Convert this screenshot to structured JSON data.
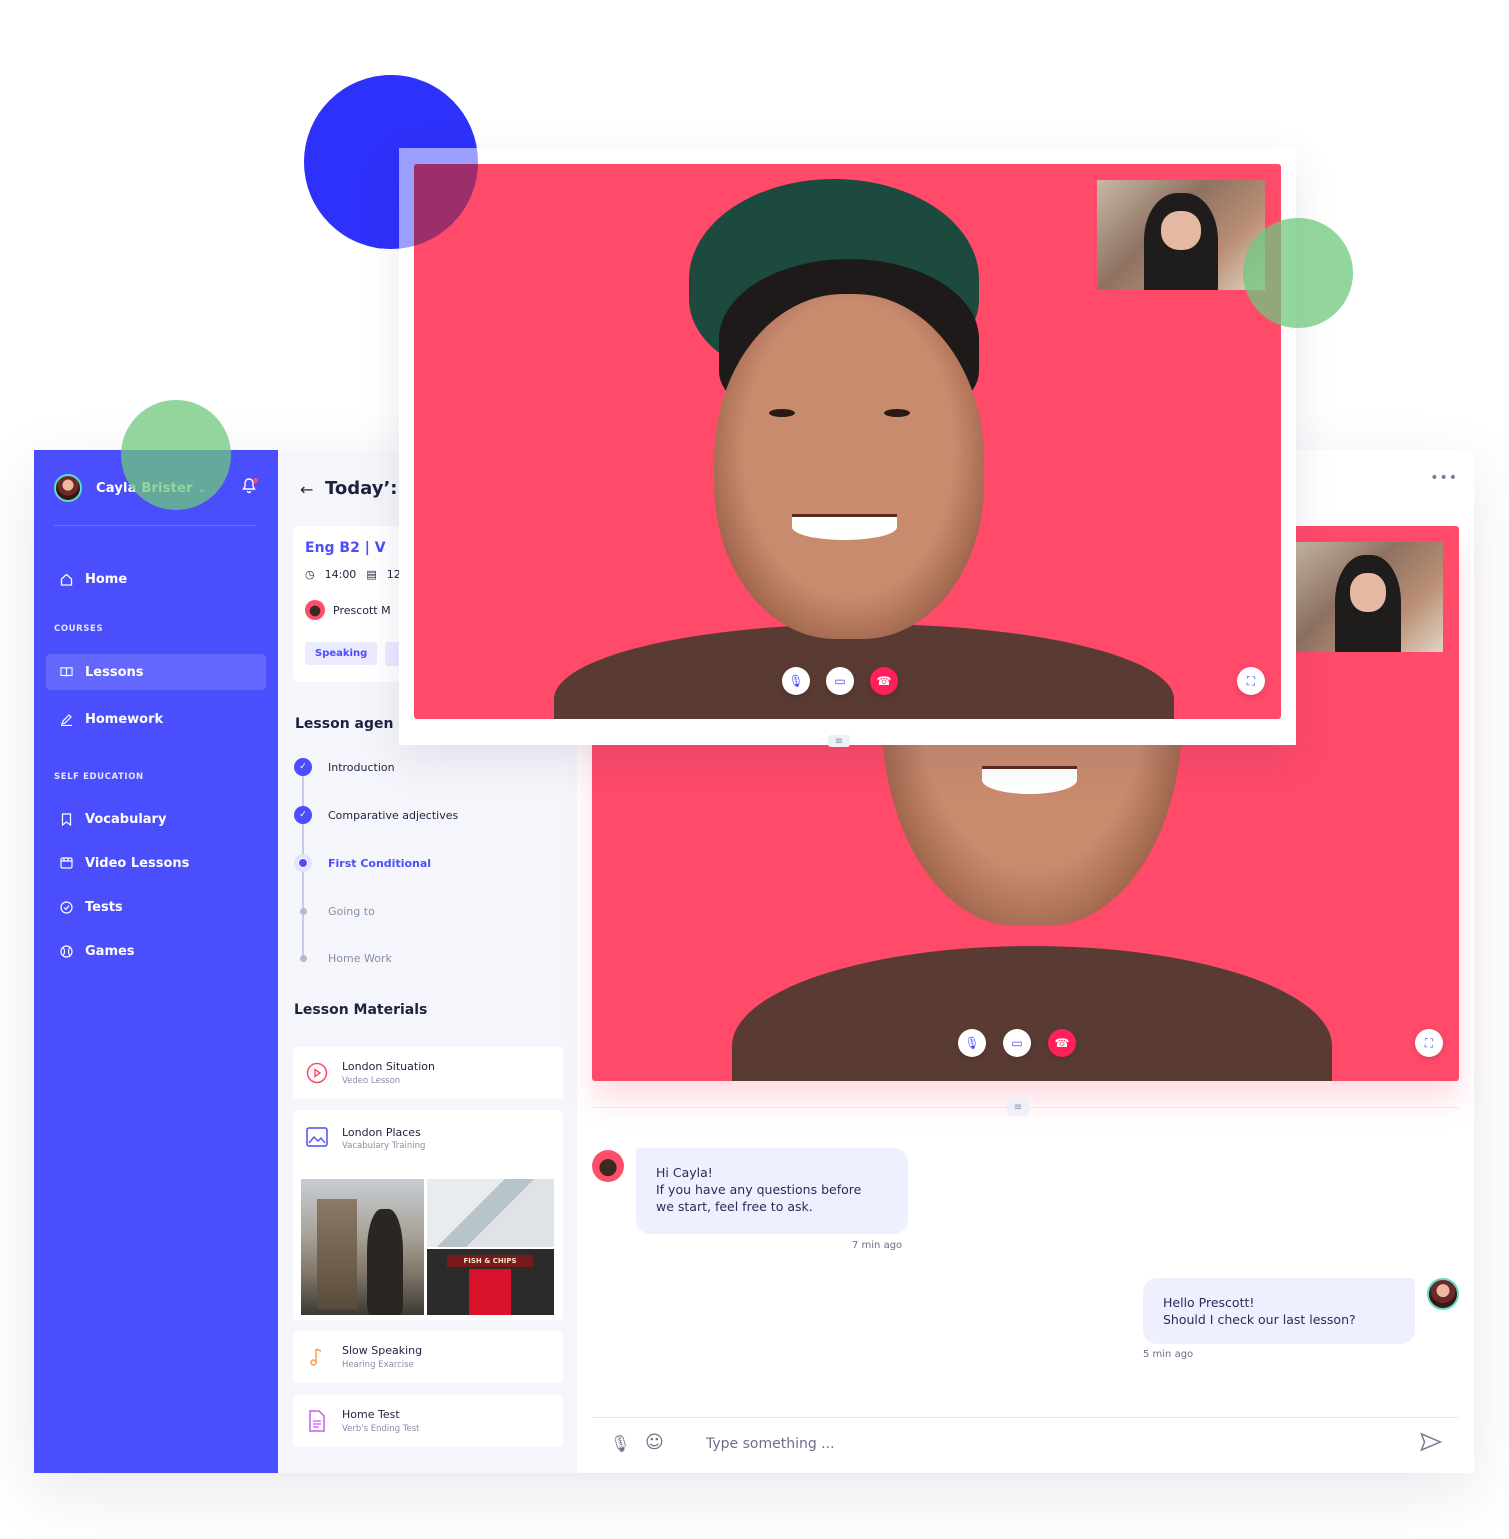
{
  "user": {
    "name": "Cayla Brister"
  },
  "nav": {
    "home": "Home",
    "courses_section": "COURSES",
    "lessons": "Lessons",
    "homework": "Homework",
    "self_section": "SELF EDUCATION",
    "vocabulary": "Vocabulary",
    "video_lessons": "Video Lessons",
    "tests": "Tests",
    "games": "Games"
  },
  "lesson": {
    "header": "Today’:",
    "title": "Eng B2  |  V",
    "time": "14:00",
    "date": "12",
    "teacher": "Prescott M",
    "tag": "Speaking"
  },
  "agenda": {
    "title": "Lesson agen",
    "steps": [
      "Introduction",
      "Comparative adjectives",
      "First Conditional",
      "Going to",
      "Home Work"
    ]
  },
  "materials": {
    "title": "Lesson Materials",
    "items": [
      {
        "title": "London Situation",
        "sub": "Vedeo Lesson"
      },
      {
        "title": "London Places",
        "sub": "Vacabulary Training"
      },
      {
        "title": "Slow Speaking",
        "sub": "Hearing Exarcise"
      },
      {
        "title": "Home Test",
        "sub": "Verb's Ending Test"
      }
    ],
    "gallery_sign": "FISH & CHIPS"
  },
  "chat": {
    "messages": [
      {
        "from": "teacher",
        "lines": [
          "Hi Cayla!",
          "If you have any questions before",
          "we start, feel free to ask."
        ],
        "time": "7 min ago"
      },
      {
        "from": "me",
        "lines": [
          "Hello Prescott!",
          "Should I check our last lesson?"
        ],
        "time": "5 min ago"
      }
    ],
    "placeholder": "Type something ..."
  },
  "colors": {
    "brand": "#4b4efc",
    "video_bg": "#ff4a6a",
    "end_call": "#ff1f5a",
    "accent_green": "#7fd38c"
  }
}
